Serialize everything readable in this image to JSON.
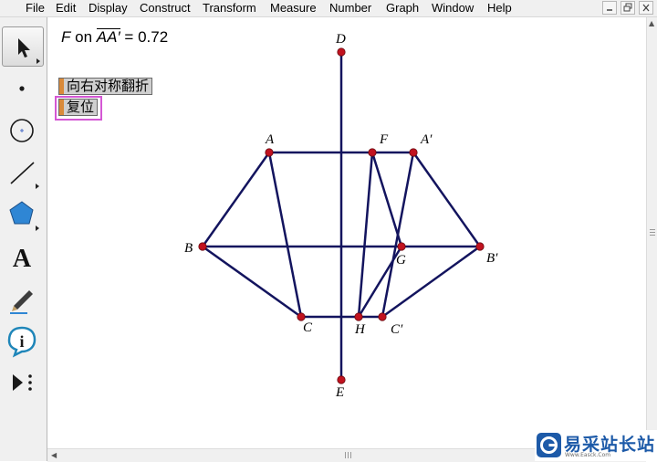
{
  "menu": [
    "File",
    "Edit",
    "Display",
    "Construct",
    "Transform",
    "Measure",
    "Number",
    "Graph",
    "Window",
    "Help"
  ],
  "window_controls": [
    "minimize-icon",
    "restore-icon",
    "close-icon"
  ],
  "toolbox": [
    {
      "name": "arrow-select-tool",
      "icon": "arrow-icon",
      "selected": true
    },
    {
      "name": "point-tool",
      "icon": "point-icon"
    },
    {
      "name": "compass-tool",
      "icon": "circle-icon"
    },
    {
      "name": "straightedge-tool",
      "icon": "segment-icon"
    },
    {
      "name": "polygon-tool",
      "icon": "pentagon-icon"
    },
    {
      "name": "text-tool",
      "icon": "text-a-icon",
      "glyph": "A"
    },
    {
      "name": "marker-tool",
      "icon": "pencil-icon"
    },
    {
      "name": "information-tool",
      "icon": "info-icon",
      "glyph": "i"
    },
    {
      "name": "custom-tool",
      "icon": "play-more-icon"
    }
  ],
  "measurement": {
    "point": "F",
    "on_word": "on",
    "segment": "AA′",
    "equals": "=",
    "value": "0.72"
  },
  "buttons": {
    "reflect_right": "向右对称翻折",
    "reset": "复位"
  },
  "points": {
    "A": "A",
    "F": "F",
    "A_prime": "A′",
    "B": "B",
    "G": "G",
    "B_prime": "B′",
    "C": "C",
    "H": "H",
    "C_prime": "C′",
    "D": "D",
    "E": "E"
  },
  "watermark": {
    "text": "易采站长站",
    "subtext": "Www.Easck.Com"
  },
  "colors": {
    "segment": "#13145e",
    "point": "#c1121f",
    "button_tab": "#d98a3a",
    "selection": "#d457d4",
    "watermark": "#1d5aa8"
  }
}
